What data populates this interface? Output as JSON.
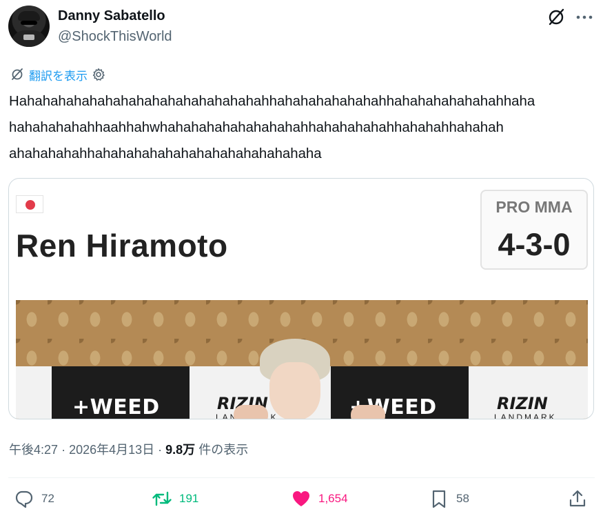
{
  "user": {
    "name": "Danny Sabatello",
    "handle": "@ShockThisWorld"
  },
  "translate": {
    "label": "翻訳を表示"
  },
  "tweet": {
    "lines": [
      "Hahahahahahahahahahahahahahahahahhahahahahahahahhahahahahahahahhaha",
      "hahahahahahhaahhahwhahahahahahahahahahhahahahahahhahahahhahahah",
      "ahahahahahhahahahahahahahahahahahahahaha"
    ]
  },
  "card": {
    "fighter_name": "Ren Hiramoto",
    "record_label": "PRO MMA",
    "record_value": "4-3-0",
    "sponsor_1": "+WEED",
    "sponsor_2": "+WEED",
    "brand_1": "RIZIN",
    "brand_2": "RIZIN",
    "brand_sub_1": "LANDMARK",
    "brand_sub_2": "LANDMARK"
  },
  "meta": {
    "time": "午後4:27",
    "date": "2026年4月13日",
    "views_count": "9.8万",
    "views_label": "件の表示"
  },
  "actions": {
    "replies": "72",
    "reposts": "191",
    "likes": "1,654",
    "bookmarks": "58"
  },
  "colors": {
    "accent": "#1d9bf0",
    "repost": "#00ba7c",
    "like": "#f91880",
    "muted": "#536471",
    "text": "#0f1419"
  }
}
